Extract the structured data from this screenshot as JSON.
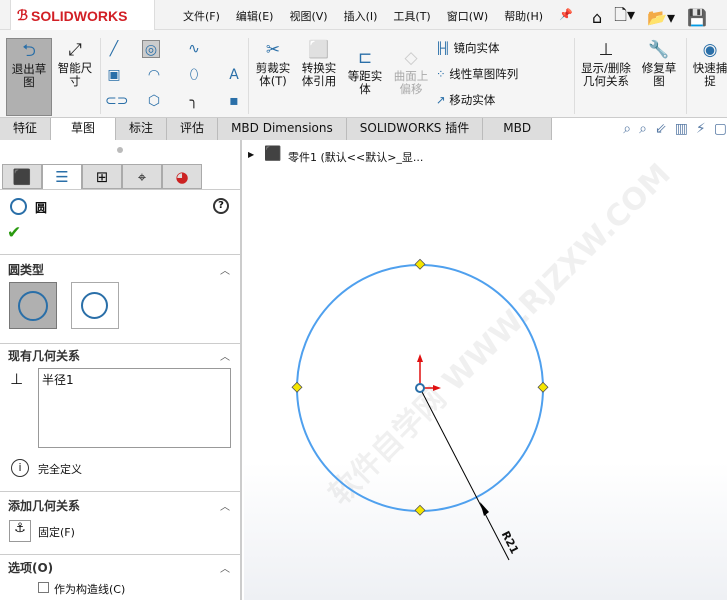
{
  "app": {
    "logo": "SOLIDWORKS"
  },
  "menu": [
    "文件(F)",
    "编辑(E)",
    "视图(V)",
    "插入(I)",
    "工具(T)",
    "窗口(W)",
    "帮助(H)"
  ],
  "ribbon": {
    "exit_sketch": "退出草图",
    "smart_dim": "智能尺寸",
    "trim": "剪裁实体(T)",
    "convert": "转换实体引用",
    "offset": "等距实体",
    "surface_offset": "曲面上偏移",
    "mirror": "镜向实体",
    "linear_pattern": "线性草图阵列",
    "move": "移动实体",
    "display_relations": "显示/删除几何关系",
    "repair": "修复草图",
    "quick_snap": "快速捕捉"
  },
  "tabs": [
    "特征",
    "草图",
    "标注",
    "评估",
    "MBD Dimensions",
    "SOLIDWORKS 插件",
    "MBD"
  ],
  "tree": {
    "item": "零件1 (默认<<默认>_显..."
  },
  "panel": {
    "title": "圆",
    "circle_type": "圆类型",
    "existing_relations": "现有几何关系",
    "relations": [
      "半径1"
    ],
    "status": "完全定义",
    "add_relations": "添加几何关系",
    "fix": "固定(F)",
    "options": "选项(O)",
    "construction": "作为构造线(C)"
  },
  "canvas": {
    "dimension": "R21",
    "watermark": "软件自学网 WWW.RJZXW.COM"
  },
  "colors": {
    "curve": "#4fa0ee",
    "point": "#f5e600",
    "brand": "#d21f25"
  }
}
